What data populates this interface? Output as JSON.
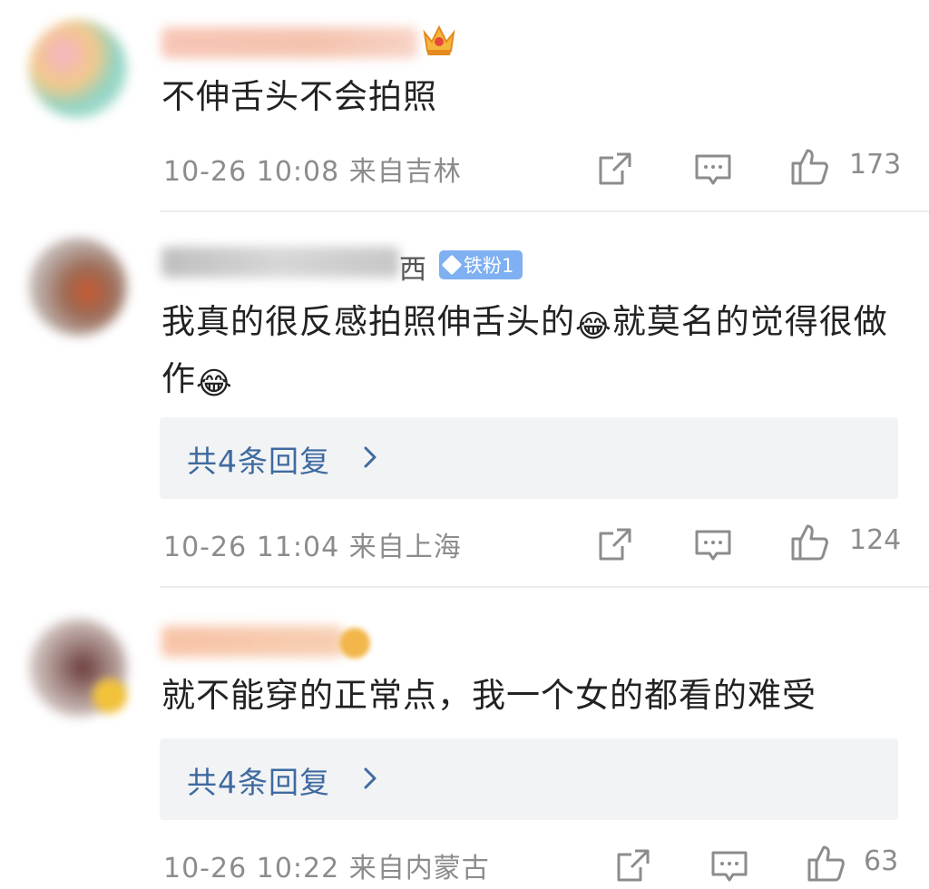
{
  "comments": [
    {
      "username": "",
      "content": "不伸舌头不会拍照",
      "date": "10-26",
      "time": "10:08",
      "location": "来自吉林",
      "likes": "173",
      "badge": "crown-level-4-icon"
    },
    {
      "username_tail": "西",
      "badge_label": "铁粉1",
      "content_part1": "我真的很反感拍照伸舌头的",
      "content_part2": "就莫名的觉得很做作",
      "emoji": "😂",
      "replies_label": "共4条回复",
      "date": "10-26",
      "time": "11:04",
      "location": "来自上海",
      "likes": "124"
    },
    {
      "username": "",
      "content": "就不能穿的正常点，我一个女的都看的难受",
      "replies_label": "共4条回复",
      "date": "10-26",
      "time": "10:22",
      "location": "来自内蒙古",
      "likes": "63"
    }
  ],
  "colors": {
    "reply_link": "#3e6aa0",
    "meta_text": "#8c8c8c",
    "reply_bg": "#f2f3f5",
    "badge_bg": "#7fb0f2"
  }
}
